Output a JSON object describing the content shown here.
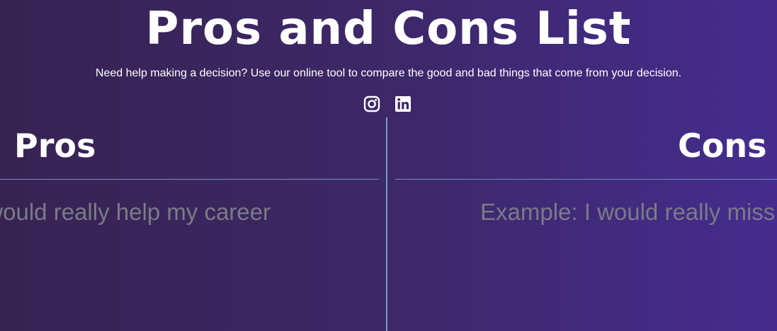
{
  "header": {
    "title": "Pros and Cons List",
    "tagline": "Need help making a decision? Use our online tool to compare the good and bad things that come from your decision."
  },
  "social": {
    "links": [
      {
        "icon": "instagram-icon"
      },
      {
        "icon": "linkedin-icon"
      }
    ]
  },
  "columns": {
    "pros": {
      "heading": "Pros",
      "placeholder": "Example: I would really help my career"
    },
    "cons": {
      "heading": "Cons",
      "placeholder": "Example: I would really miss my friends"
    }
  },
  "colors": {
    "background_start": "#372352",
    "background_end": "#452c8e",
    "divider": "#6da0c8",
    "placeholder_text": "#7a7b86",
    "text": "#ffffff"
  }
}
